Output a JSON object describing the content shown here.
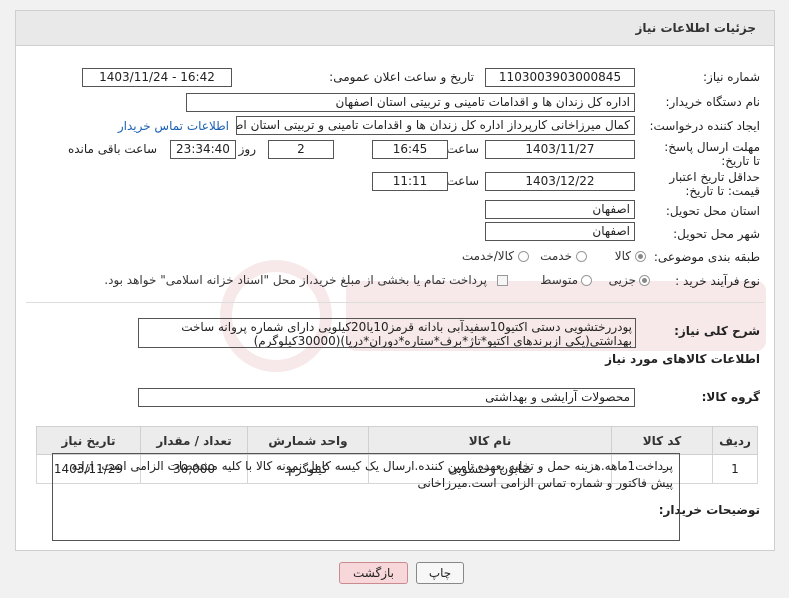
{
  "header": {
    "title": "جزئیات اطلاعات نیاز"
  },
  "fields": {
    "need_number_label": "شماره نیاز:",
    "need_number_value": "1103003903000845",
    "announce_label": "تاریخ و ساعت اعلان عمومی:",
    "announce_value": "1403/11/24 - 16:42",
    "buyer_org_label": "نام دستگاه خریدار:",
    "buyer_org_value": "اداره کل زندان ها و اقدامات تامینی و تربیتی استان اصفهان",
    "creator_label": "ایجاد کننده درخواست:",
    "creator_value": "کمال میرزاخانی کارپرداز اداره کل زندان ها و اقدامات تامینی و تربیتی استان اصفهان",
    "contact_link": "اطلاعات تماس خریدار",
    "deadline_label": "مهلت ارسال پاسخ: تا تاریخ:",
    "deadline_date": "1403/11/27",
    "time_label": "ساعت",
    "deadline_time": "16:45",
    "days_value": "2",
    "days_label": "روز و",
    "remaining_value": "23:34:40",
    "remaining_label": "ساعت باقی مانده",
    "validity_label": "حداقل تاریخ اعتبار قیمت: تا تاریخ:",
    "validity_date": "1403/12/22",
    "validity_time": "11:11",
    "province_label": "استان محل تحویل:",
    "province_value": "اصفهان",
    "city_label": "شهر محل تحویل:",
    "city_value": "اصفهان",
    "category_label": "طبقه بندی موضوعی:",
    "category_options": [
      "کالا",
      "خدمت",
      "کالا/خدمت"
    ],
    "process_label": "نوع فرآیند خرید :",
    "process_options": [
      "جزیی",
      "متوسط"
    ],
    "payment_note": "پرداخت تمام یا بخشی از مبلغ خرید،از محل \"اسناد خزانه اسلامی\" خواهد بود."
  },
  "description": {
    "label": "شرح کلی نیاز:",
    "text": "پودررختشویی دستی اکتیو10سفیدآبی بادانه قرمز10یا20کیلویی دارای شماره پروانه ساخت بهداشتی(یکی ازبرندهای اکتیو*تاژ*برف*ستاره*دوران*دریا)(30000کیلوگرم)"
  },
  "goods": {
    "section_title": "اطلاعات کالاهای مورد نیاز",
    "group_label": "گروه کالا:",
    "group_value": "محصولات آرایشی و بهداشتی",
    "columns": [
      "ردیف",
      "کد کالا",
      "نام کالا",
      "واحد شمارش",
      "تعداد / مقدار",
      "تاریخ نیاز"
    ],
    "rows": [
      {
        "index": "1",
        "code": "--",
        "name": "صابون رختشویی",
        "unit": "کیلوگرم",
        "qty": "30,000",
        "date": "1403/11/29"
      }
    ]
  },
  "buyer_notes": {
    "label": "توضیحات خریدار:",
    "text": "پرداخت1ماهه.هزینه حمل و تخلیه بعهده تامین کننده.ارسال یک کیسه کامل نمونه کالا با کلیه مشخصات الزامی است. ارایه پیش فاکتور و شماره تماس الزامی است.میرزاخانی"
  },
  "buttons": {
    "print": "چاپ",
    "back": "بازگشت"
  },
  "colors": {
    "header_bg": "#e9e9e9",
    "link": "#1a5fb4",
    "back_button_bg": "#f8d7da"
  }
}
